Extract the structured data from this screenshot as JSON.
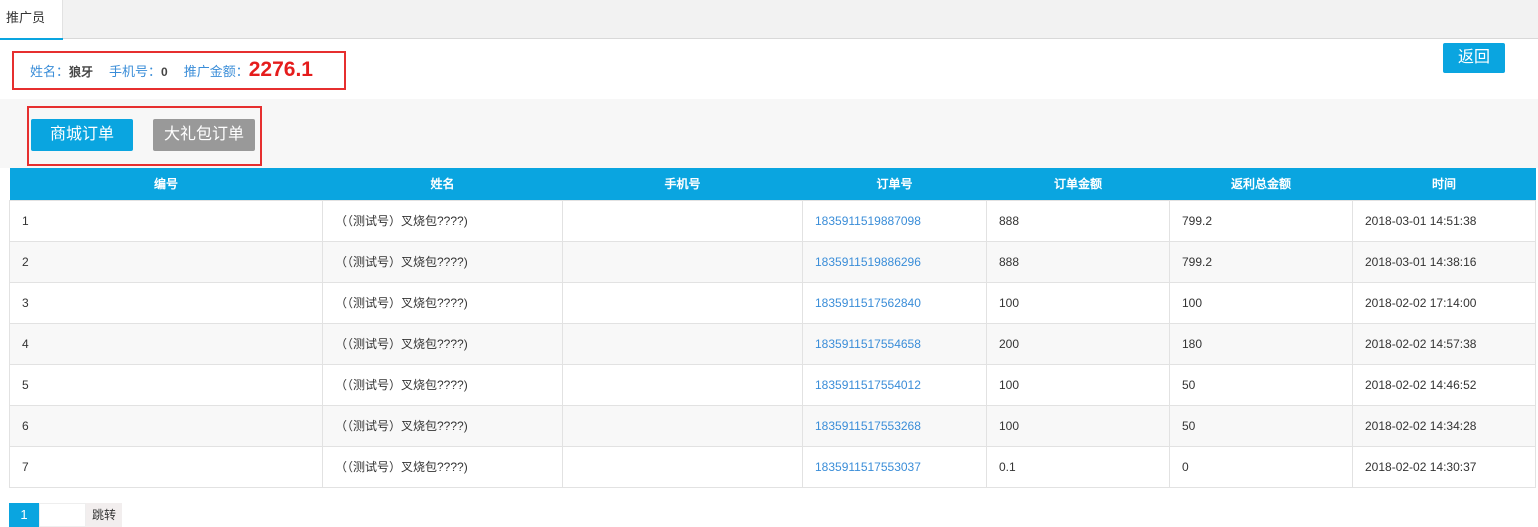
{
  "tab": {
    "label": "推广员"
  },
  "info": {
    "name_label": "姓名：",
    "name_value": "狼牙",
    "phone_label": "手机号：",
    "phone_value": "0",
    "amount_label": "推广金额：",
    "amount_value": "2276.1"
  },
  "buttons": {
    "back": "返回",
    "mall_orders": "商城订单",
    "gift_orders": "大礼包订单"
  },
  "table": {
    "headers": [
      "编号",
      "姓名",
      "手机号",
      "订单号",
      "订单金额",
      "返利总金额",
      "时间"
    ],
    "rows": [
      [
        "1",
        "（（测试号）叉烧包????)",
        "",
        "1835911519887098",
        "888",
        "799.2",
        "2018-03-01 14:51:38"
      ],
      [
        "2",
        "（（测试号）叉烧包????)",
        "",
        "1835911519886296",
        "888",
        "799.2",
        "2018-03-01 14:38:16"
      ],
      [
        "3",
        "（（测试号）叉烧包????)",
        "",
        "1835911517562840",
        "100",
        "100",
        "2018-02-02 17:14:00"
      ],
      [
        "4",
        "（（测试号）叉烧包????)",
        "",
        "1835911517554658",
        "200",
        "180",
        "2018-02-02 14:57:38"
      ],
      [
        "5",
        "（（测试号）叉烧包????)",
        "",
        "1835911517554012",
        "100",
        "50",
        "2018-02-02 14:46:52"
      ],
      [
        "6",
        "（（测试号）叉烧包????)",
        "",
        "1835911517553268",
        "100",
        "50",
        "2018-02-02 14:34:28"
      ],
      [
        "7",
        "（（测试号）叉烧包????)",
        "",
        "1835911517553037",
        "0.1",
        "0",
        "2018-02-02 14:30:37"
      ]
    ]
  },
  "pagination": {
    "current_page": "1",
    "input_value": "",
    "jump_label": "跳转"
  }
}
